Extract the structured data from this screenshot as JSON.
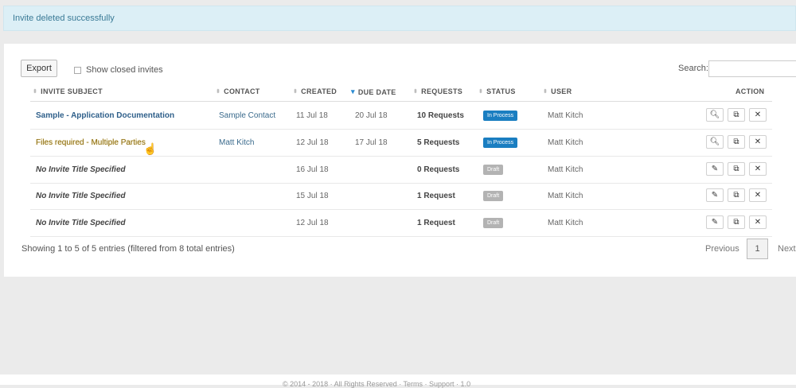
{
  "alert": {
    "text": "Invite deleted successfully"
  },
  "toolbar": {
    "export_label": "Export",
    "show_closed_label": "Show closed invites",
    "search_label": "Search:",
    "search_value": ""
  },
  "columns": {
    "subject": "INVITE SUBJECT",
    "contact": "CONTACT",
    "created": "CREATED",
    "due": "DUE DATE",
    "requests": "REQUESTS",
    "status": "STATUS",
    "user": "USER",
    "action": "ACTION"
  },
  "rows": [
    {
      "subject": "Sample - Application Documentation",
      "contact": "Sample Contact",
      "created": "11 Jul 18",
      "due": "20 Jul 18",
      "requests": "10 Requests",
      "status": "In Process",
      "user": "Matt Kitch",
      "actions": [
        "view-icon",
        "copy-icon",
        "delete-icon"
      ]
    },
    {
      "subject": "Files required - Multiple Parties",
      "contact": "Matt Kitch",
      "created": "12 Jul 18",
      "due": "17 Jul 18",
      "requests": "5 Requests",
      "status": "In Process",
      "user": "Matt Kitch",
      "actions": [
        "view-icon",
        "copy-icon",
        "delete-icon"
      ]
    },
    {
      "subject": "No Invite Title Specified",
      "contact": "",
      "created": "16 Jul 18",
      "due": "",
      "requests": "0 Requests",
      "status": "Draft",
      "user": "Matt Kitch",
      "actions": [
        "edit-icon",
        "copy-icon",
        "delete-icon"
      ]
    },
    {
      "subject": "No Invite Title Specified",
      "contact": "",
      "created": "15 Jul 18",
      "due": "",
      "requests": "1 Request",
      "status": "Draft",
      "user": "Matt Kitch",
      "actions": [
        "edit-icon",
        "copy-icon",
        "delete-icon"
      ]
    },
    {
      "subject": "No Invite Title Specified",
      "contact": "",
      "created": "12 Jul 18",
      "due": "",
      "requests": "1 Request",
      "status": "Draft",
      "user": "Matt Kitch",
      "actions": [
        "edit-icon",
        "copy-icon",
        "delete-icon"
      ]
    }
  ],
  "pagination": {
    "info": "Showing 1 to 5 of 5 entries (filtered from 8 total entries)",
    "previous": "Previous",
    "page": "1",
    "next": "Next"
  },
  "footer": {
    "text": "© 2014 - 2018 · All Rights Reserved · Terms · Support · 1.0"
  },
  "colors": {
    "in_process": "#1a7ec1",
    "draft": "#b3b3b3",
    "link": "#2e5f8a",
    "alert_bg": "#dceff6"
  }
}
